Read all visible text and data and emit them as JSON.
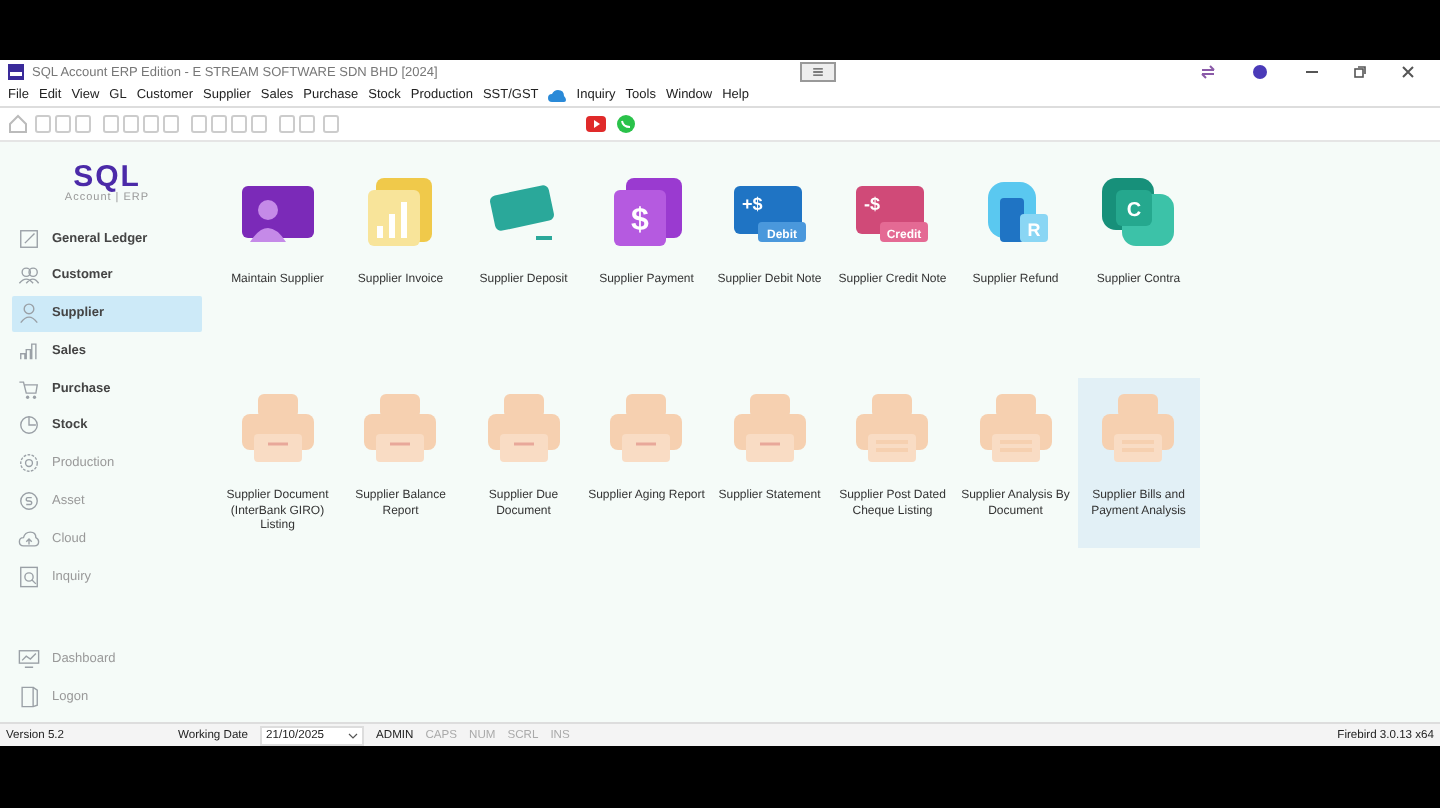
{
  "window": {
    "title": "SQL Account ERP Edition - E STREAM SOFTWARE SDN BHD [2024]"
  },
  "menu": [
    "File",
    "Edit",
    "View",
    "GL",
    "Customer",
    "Supplier",
    "Sales",
    "Purchase",
    "Stock",
    "Production",
    "SST/GST",
    "Inquiry",
    "Tools",
    "Window",
    "Help"
  ],
  "logo": {
    "name": "SQL",
    "subtitle": "Account | ERP"
  },
  "sidebar": {
    "items": [
      {
        "label": "General Ledger",
        "kind": "ledger",
        "selected": false,
        "disabled": false
      },
      {
        "label": "Customer",
        "kind": "people",
        "selected": false,
        "disabled": false
      },
      {
        "label": "Supplier",
        "kind": "person",
        "selected": true,
        "disabled": false
      },
      {
        "label": "Sales",
        "kind": "chart",
        "selected": false,
        "disabled": false
      },
      {
        "label": "Purchase",
        "kind": "cart",
        "selected": false,
        "disabled": false
      },
      {
        "label": "Stock",
        "kind": "box",
        "selected": false,
        "disabled": false
      },
      {
        "label": "Production",
        "kind": "gear",
        "selected": false,
        "disabled": true
      },
      {
        "label": "Asset",
        "kind": "coin",
        "selected": false,
        "disabled": true
      },
      {
        "label": "Cloud",
        "kind": "cloud",
        "selected": false,
        "disabled": true
      },
      {
        "label": "Inquiry",
        "kind": "search",
        "selected": false,
        "disabled": true
      }
    ],
    "bottom_items": [
      {
        "label": "Dashboard",
        "kind": "monitor",
        "disabled": true
      },
      {
        "label": "Logon",
        "kind": "door",
        "disabled": true
      }
    ]
  },
  "tiles": [
    {
      "label": "Maintain Supplier",
      "kind": "person",
      "selected": false
    },
    {
      "label": "Supplier Invoice",
      "kind": "bars",
      "selected": false
    },
    {
      "label": "Supplier Deposit",
      "kind": "card",
      "selected": false
    },
    {
      "label": "Supplier Payment",
      "kind": "dollar",
      "badge": "$",
      "selected": false
    },
    {
      "label": "Supplier Debit Note",
      "kind": "debit",
      "badge": "+$",
      "tag": "Debit",
      "selected": false
    },
    {
      "label": "Supplier Credit Note",
      "kind": "credit",
      "badge": "-$",
      "tag": "Credit",
      "selected": false
    },
    {
      "label": "Supplier Refund",
      "kind": "refund",
      "badge": "R",
      "selected": false
    },
    {
      "label": "Supplier Contra",
      "kind": "contra",
      "badge": "C",
      "selected": false
    },
    {
      "label": "Supplier Document (InterBank GIRO) Listing",
      "kind": "printer",
      "selected": false
    },
    {
      "label": "Supplier Balance Report",
      "kind": "printer",
      "selected": false
    },
    {
      "label": "Supplier Due Document",
      "kind": "printer",
      "selected": false
    },
    {
      "label": "Supplier Aging Report",
      "kind": "printer",
      "selected": false
    },
    {
      "label": "Supplier Statement",
      "kind": "printer",
      "selected": false
    },
    {
      "label": "Supplier Post Dated Cheque Listing",
      "kind": "printer-doc",
      "selected": false
    },
    {
      "label": "Supplier Analysis By Document",
      "kind": "printer-doc",
      "selected": false
    },
    {
      "label": "Supplier Bills and Payment Analysis",
      "kind": "printer-doc",
      "selected": true
    }
  ],
  "status_bar": {
    "version": "Version 5.2",
    "working_date_label": "Working Date",
    "working_date": "21/10/2025",
    "user": "ADMIN",
    "keys": [
      {
        "label": "CAPS",
        "on": false
      },
      {
        "label": "NUM",
        "on": false
      },
      {
        "label": "SCRL",
        "on": false
      },
      {
        "label": "INS",
        "on": false
      }
    ],
    "database": "Firebird 3.0.13 x64"
  }
}
